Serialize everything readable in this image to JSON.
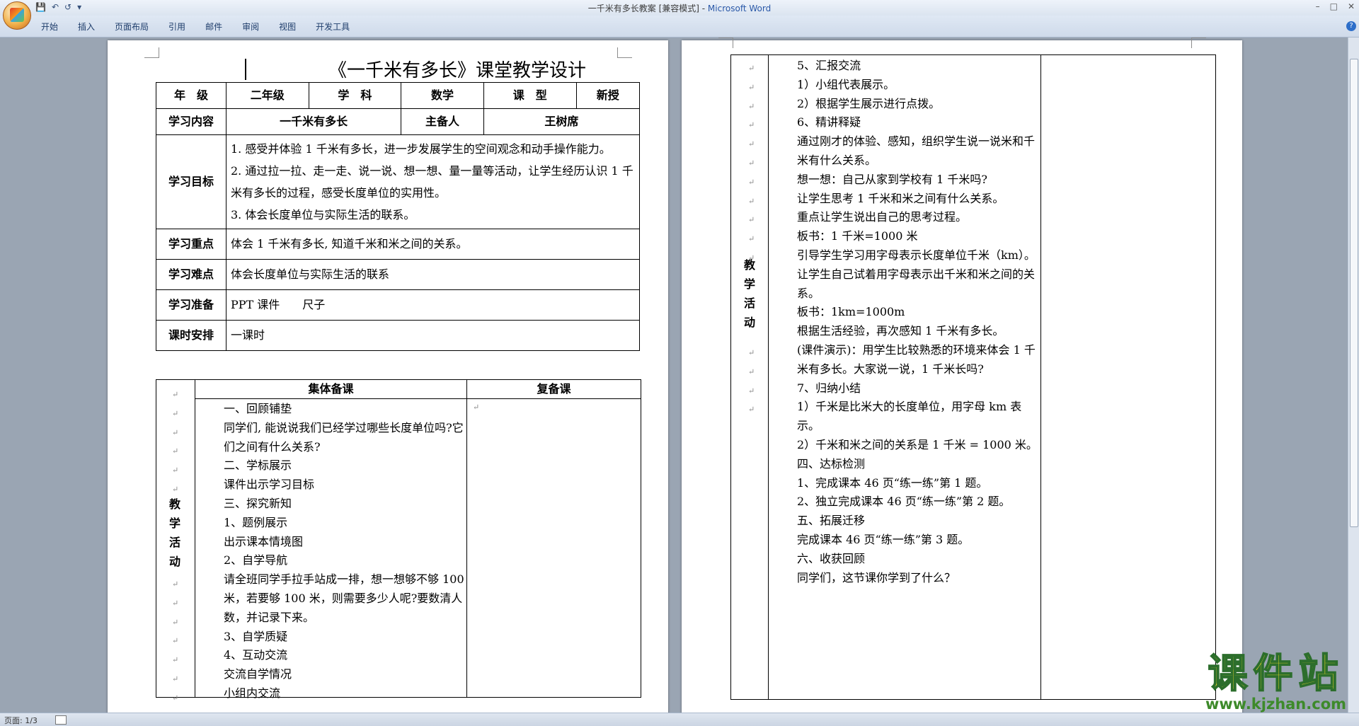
{
  "window": {
    "title": "一千米有多长教案 [兼容模式] - ",
    "app_name": "Microsoft Word"
  },
  "ribbon": {
    "tabs": [
      "开始",
      "插入",
      "页面布局",
      "引用",
      "邮件",
      "审阅",
      "视图",
      "开发工具"
    ]
  },
  "doc": {
    "title": "《一千米有多长》课堂教学设计",
    "info": {
      "grade_label": "年　级",
      "grade_value": "二年级",
      "subject_label": "学　科",
      "subject_value": "数学",
      "type_label": "课　型",
      "type_value": "新授",
      "content_label": "学习内容",
      "content_value": "一千米有多长",
      "owner_label": "主备人",
      "owner_value": "王树席",
      "goal_label": "学习目标",
      "goals": [
        "1. 感受并体验 1 千米有多长，进一步发展学生的空间观念和动手操作能力。",
        "2. 通过拉一拉、走一走、说一说、想一想、量一量等活动，让学生经历认识 1 千米有多长的过程，感受长度单位的实用性。",
        "3.  体会长度单位与实际生活的联系。"
      ],
      "key_label": "学习重点",
      "key_value": "体会 1 千米有多长, 知道千米和米之间的关系。",
      "difficulty_label": "学习难点",
      "difficulty_value": "体会长度单位与实际生活的联系",
      "prep_label": "学习准备",
      "prep_value": "PPT 课件　　尺子",
      "time_label": "课时安排",
      "time_value": "一课时"
    },
    "activity": {
      "group_header": "集体备课",
      "review_header": "复备课",
      "side_label": [
        "教",
        "学",
        "活",
        "动"
      ],
      "lines_page1": [
        "一、回顾铺垫",
        "同学们, 能说说我们已经学过哪些长度单位吗?它们之间有什么关系?",
        "二、学标展示",
        "课件出示学习目标",
        "三、探究新知",
        "1、题例展示",
        "出示课本情境图",
        "2、自学导航",
        "请全班同学手拉手站成一排，想一想够不够 100 米，若要够 100 米，则需要多少人呢?要数清人数，并记录下来。",
        "3、自学质疑",
        "4、互动交流",
        "交流自学情况",
        "小组内交流"
      ],
      "lines_page2": [
        "5、汇报交流",
        "1）小组代表展示。",
        "2）根据学生展示进行点拨。",
        "6、精讲释疑",
        "通过刚才的体验、感知，组织学生说一说米和千米有什么关系。",
        "想一想：自己从家到学校有 1 千米吗?",
        "让学生思考 1 千米和米之间有什么关系。",
        "重点让学生说出自己的思考过程。",
        "板书：1 千米=1000 米",
        "引导学生学习用字母表示长度单位千米（km）。",
        "让学生自己试着用字母表示出千米和米之间的关系。",
        "板书：1km=1000m",
        "根据生活经验，再次感知 1 千米有多长。",
        "(课件演示)：用学生比较熟悉的环境来体会 1 千米有多长。大家说一说，1 千米长吗?",
        "7、归纳小结",
        "1）千米是比米大的长度单位，用字母 km 表示。",
        "2）千米和米之间的关系是 1 千米 = 1000 米。",
        "四、达标检测",
        "1、完成课本 46 页“练一练”第 1 题。",
        "2、独立完成课本 46 页“练一练”第 2 题。",
        "五、拓展迁移",
        "完成课本 46 页“练一练”第 3 题。",
        "六、收获回顾",
        "同学们，这节课你学到了什么？"
      ]
    }
  },
  "status": {
    "page": "页面: 1/3"
  },
  "watermark": {
    "text": "课件站",
    "url": "www.kjzhan.com"
  }
}
